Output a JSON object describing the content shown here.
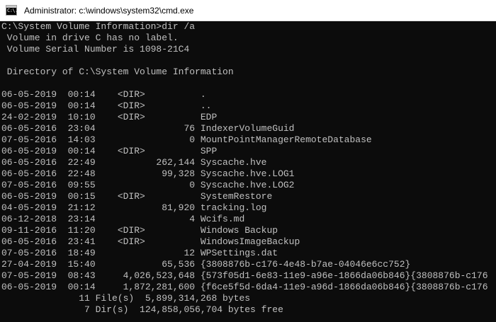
{
  "window": {
    "title": "Administrator: c:\\windows\\system32\\cmd.exe",
    "icon": "cmd-icon",
    "icon_glyph": "C:\\."
  },
  "console": {
    "lines": [
      "C:\\System Volume Information>dir /a",
      " Volume in drive C has no label.",
      " Volume Serial Number is 1098-21C4",
      "",
      " Directory of C:\\System Volume Information",
      "",
      "06-05-2019  00:14    <DIR>          .",
      "06-05-2019  00:14    <DIR>          ..",
      "24-02-2019  10:10    <DIR>          EDP",
      "06-05-2016  23:04                76 IndexerVolumeGuid",
      "07-05-2016  14:03                 0 MountPointManagerRemoteDatabase",
      "06-05-2019  00:14    <DIR>          SPP",
      "06-05-2016  22:49           262,144 Syscache.hve",
      "06-05-2016  22:48            99,328 Syscache.hve.LOG1",
      "07-05-2016  09:55                 0 Syscache.hve.LOG2",
      "06-05-2019  00:15    <DIR>          SystemRestore",
      "04-05-2019  21:12            81,920 tracking.log",
      "06-12-2018  23:14                 4 Wcifs.md",
      "09-11-2016  11:20    <DIR>          Windows Backup",
      "06-05-2016  23:41    <DIR>          WindowsImageBackup",
      "07-05-2016  18:49                12 WPSettings.dat",
      "27-04-2019  15:40            65,536 {3808876b-c176-4e48-b7ae-04046e6cc752}",
      "07-05-2019  08:43     4,026,523,648 {573f05d1-6e83-11e9-a96e-1866da06b846}{3808876b-c176",
      "06-05-2019  00:14     1,872,281,600 {f6ce5f5d-6da4-11e9-a96d-1866da06b846}{3808876b-c176",
      "              11 File(s)  5,899,314,268 bytes",
      "               7 Dir(s)  124,858,056,704 bytes free"
    ]
  }
}
